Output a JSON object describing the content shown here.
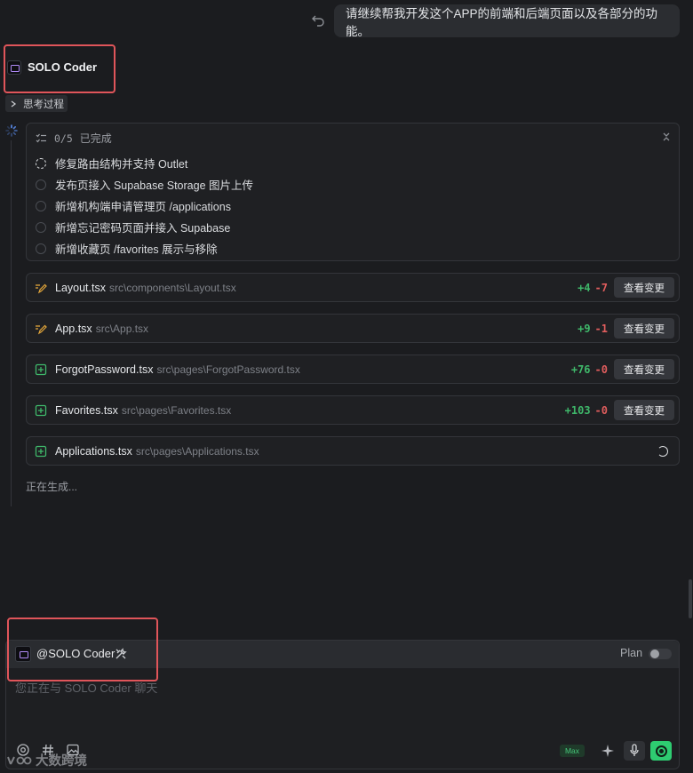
{
  "user_message": "请继续帮我开发这个APP的前端和后端页面以及各部分的功能。",
  "agent": {
    "name": "SOLO Coder",
    "thought_toggle": "思考过程"
  },
  "tasks": {
    "progress_count": "0/5",
    "progress_label": "已完成",
    "items": [
      "修复路由结构并支持 Outlet",
      "发布页接入 Supabase Storage 图片上传",
      "新增机构端申请管理页 /applications",
      "新增忘记密码页面并接入 Supabase",
      "新增收藏页 /favorites 展示与移除"
    ]
  },
  "files": [
    {
      "name": "Layout.tsx",
      "path": "src\\components\\Layout.tsx",
      "added": "+4",
      "removed": "-7",
      "action": "查看变更",
      "status": "modified"
    },
    {
      "name": "App.tsx",
      "path": "src\\App.tsx",
      "added": "+9",
      "removed": "-1",
      "action": "查看变更",
      "status": "modified"
    },
    {
      "name": "ForgotPassword.tsx",
      "path": "src\\pages\\ForgotPassword.tsx",
      "added": "+76",
      "removed": "-0",
      "action": "查看变更",
      "status": "created"
    },
    {
      "name": "Favorites.tsx",
      "path": "src\\pages\\Favorites.tsx",
      "added": "+103",
      "removed": "-0",
      "action": "查看变更",
      "status": "created"
    },
    {
      "name": "Applications.tsx",
      "path": "src\\pages\\Applications.tsx",
      "status": "generating"
    }
  ],
  "generating_status": "正在生成...",
  "composer": {
    "mention": "@SOLO Coder",
    "plan_label": "Plan",
    "placeholder": "您正在与 SOLO Coder 聊天",
    "max_badge": "Max"
  },
  "watermark": "大数跨境",
  "colors": {
    "background": "#1b1c1f",
    "added": "#3fb86a",
    "removed": "#e05d5d",
    "send_button": "#2ecc71",
    "highlight": "#e0555a",
    "agent_accent": "#b18bf7"
  }
}
